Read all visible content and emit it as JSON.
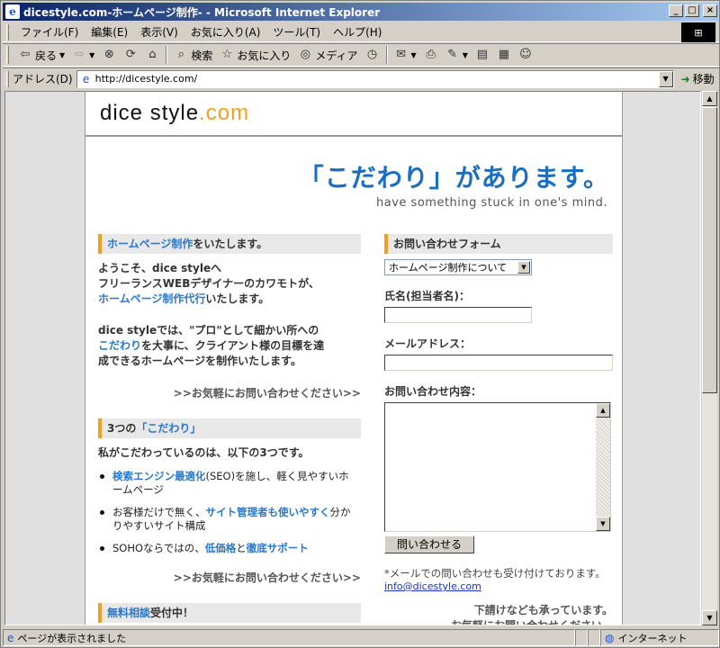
{
  "window": {
    "title": "dicestyle.com-ホームページ制作- - Microsoft Internet Explorer",
    "app_icon": "ie-icon",
    "minimize": "_",
    "maximize": "□",
    "close": "×"
  },
  "menu": {
    "items": [
      "ファイル(F)",
      "編集(E)",
      "表示(V)",
      "お気に入り(A)",
      "ツール(T)",
      "ヘルプ(H)"
    ]
  },
  "toolbar": {
    "back_label": "戻る",
    "search_label": "検索",
    "favorites_label": "お気に入り",
    "media_label": "メディア"
  },
  "address": {
    "label": "アドレス(D)",
    "url": "http://dicestyle.com/",
    "go_label": "移動"
  },
  "site": {
    "logo_main": "dice style",
    "logo_suffix": ".com",
    "catch": "「こだわり」があります。",
    "catch_en": "have something stuck in one's mind.",
    "intro": {
      "heading_highlight": "ホームページ制作",
      "heading_rest": "をいたします。",
      "line1": "ようこそ、dice styleへ",
      "line2": "フリーランスWEBデザイナーのカワモトが、",
      "line3_highlight": "ホームページ制作代行",
      "line3_rest": "いたします。",
      "para_line1": "dice styleでは、\"プロ\"として細かい所への",
      "para_line2_highlight": "こだわり",
      "para_line2_rest": "を大事に、クライアント様の目標を達",
      "para_line3": "成できるホームページを制作いたします。",
      "more": ">>お気軽にお問い合わせください>>"
    },
    "three": {
      "heading_prefix": "3つの",
      "heading_highlight": "「こだわり」",
      "lead": "私がこだわっているのは、以下の3つです。",
      "points": [
        {
          "highlight": "検索エンジン最適化",
          "rest1": "(SEO)を施し、軽く見やすいホ",
          "rest2": "ームページ"
        },
        {
          "pre": "お客様だけで無く、",
          "highlight": "サイト管理者も使いやすく",
          "rest1": "分か",
          "rest2": "りやすいサイト構成"
        },
        {
          "pre": "SOHOならではの、",
          "highlight": "低価格",
          "mid": "と",
          "highlight2": "徹底サポート"
        }
      ],
      "more": ">>お気軽にお問い合わせください>>"
    },
    "consult": {
      "heading_highlight": "無料相談",
      "heading_rest": "受付中！"
    },
    "form": {
      "heading": "お問い合わせフォーム",
      "select_value": "ホームページ制作について",
      "name_label": "氏名(担当者名)：",
      "email_label": "メールアドレス：",
      "message_label": "お問い合わせ内容：",
      "submit_label": "問い合わせる",
      "note": "*メールでの問い合わせも受け付けております。",
      "email": "info@dicestyle.com",
      "footer1": "下請けなども承っています。",
      "footer2": "お気軽にお問い合わせください。"
    }
  },
  "status": {
    "text": "ページが表示されました",
    "zone": "インターネット"
  }
}
